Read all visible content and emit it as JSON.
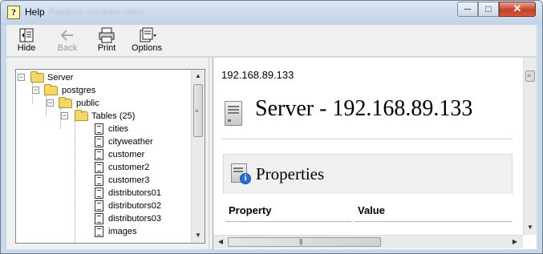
{
  "window": {
    "title": "Help",
    "blurred_title": "Pgadmin compare client",
    "buttons": {
      "minimize": "─",
      "maximize": "□",
      "close": "✕"
    }
  },
  "toolbar": {
    "hide": "Hide",
    "back": "Back",
    "print": "Print",
    "options": "Options"
  },
  "tree": {
    "server": "Server",
    "database": "postgres",
    "schema": "public",
    "tables_node": "Tables (25)",
    "tables": [
      "cities",
      "cityweather",
      "customer",
      "customer2",
      "customer3",
      "distributors01",
      "distributors02",
      "distributors03",
      "images"
    ]
  },
  "content": {
    "ip_header": "192.168.89.133",
    "title": "Server - 192.168.89.133",
    "properties_heading": "Properties",
    "columns": [
      "Property",
      "Value"
    ]
  },
  "icons": {
    "help_window": "help-book-icon",
    "hide": "hide-pane-icon",
    "back": "back-arrow-icon",
    "print": "printer-icon",
    "options": "options-icon",
    "folder": "folder-icon",
    "document": "page-icon",
    "server": "server-icon",
    "info": "info-icon"
  },
  "colors": {
    "titlebar": "#c9d8ea",
    "toolbar": "#f0f0f0",
    "close_button": "#c6412a",
    "folder": "#f2d86b"
  }
}
